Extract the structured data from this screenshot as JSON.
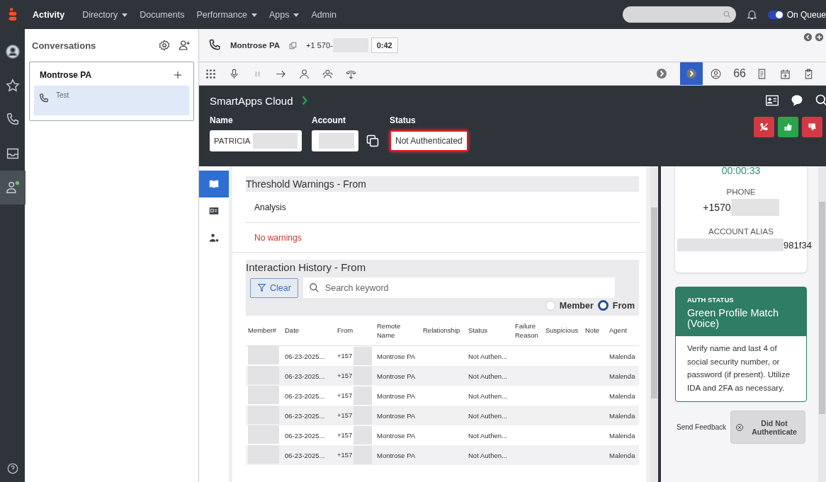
{
  "nav": {
    "items": [
      {
        "label": "Activity",
        "dropdown": false,
        "selected": true
      },
      {
        "label": "Directory",
        "dropdown": true,
        "selected": false
      },
      {
        "label": "Documents",
        "dropdown": false,
        "selected": false
      },
      {
        "label": "Performance",
        "dropdown": true,
        "selected": false
      },
      {
        "label": "Apps",
        "dropdown": true,
        "selected": false
      },
      {
        "label": "Admin",
        "dropdown": false,
        "selected": false
      }
    ],
    "queue": {
      "label": "On Queue",
      "on": true
    }
  },
  "rail": [
    {
      "kind": "avatar",
      "selected": false
    },
    {
      "kind": "star",
      "selected": false
    },
    {
      "kind": "phone",
      "selected": false
    },
    {
      "kind": "inbox",
      "selected": false
    },
    {
      "kind": "agent",
      "selected": true
    }
  ],
  "conversations": {
    "title": "Conversations",
    "groups": [
      {
        "name": "Montrose PA",
        "items": [
          {
            "label": "Test",
            "selected": true
          }
        ]
      }
    ]
  },
  "call": {
    "name": "Montrose PA",
    "phone": "+1 570-",
    "timer": "0:42"
  },
  "toolbar": {
    "count": "66",
    "panels": [
      {
        "kind": "next",
        "selected": false
      },
      {
        "kind": "next",
        "selected": true
      }
    ]
  },
  "smartapps": {
    "title": "SmartApps Cloud",
    "fields": [
      {
        "label": "Name",
        "value": "PATRICIA",
        "alert": false
      },
      {
        "label": "Account",
        "alert": false
      },
      {
        "label": "Status",
        "value": "Not Authenticated",
        "alert": true
      }
    ],
    "actions": [
      {
        "kind": "hangup"
      },
      {
        "kind": "thumbs-up"
      },
      {
        "kind": "thumbs-down"
      }
    ]
  },
  "side_tabs": [
    {
      "kind": "book",
      "selected": true
    },
    {
      "kind": "card",
      "selected": false
    },
    {
      "kind": "user",
      "selected": false
    }
  ],
  "threshold": {
    "title": "Threshold Warnings - From",
    "column": "Analysis",
    "message": "No warnings"
  },
  "history": {
    "title": "Interaction History - From",
    "clear": "Clear",
    "search_placeholder": "Search keyword",
    "radios": [
      {
        "label": "Member",
        "selected": false
      },
      {
        "label": "From",
        "selected": true
      }
    ],
    "columns": [
      "Member#",
      "Date",
      "From",
      "Remote Name",
      "Relationship",
      "Status",
      "Failure Reason",
      "Suspicious",
      "Note",
      "Agent"
    ],
    "rows": [
      {
        "date": "06-23-2025...",
        "from": "+157",
        "remote": "Montrose PA",
        "status": "Not Authen...",
        "agent": "Malenda"
      },
      {
        "date": "06-23-2025...",
        "from": "+157",
        "remote": "Montrose PA",
        "status": "Not Authen...",
        "agent": "Malenda"
      },
      {
        "date": "06-23-2025...",
        "from": "+157",
        "remote": "Montrose PA",
        "status": "Not Authen...",
        "agent": "Malenda"
      },
      {
        "date": "06-23-2025...",
        "from": "+157",
        "remote": "Montrose PA",
        "status": "Not Authen...",
        "agent": "Malenda"
      },
      {
        "date": "06-23-2025...",
        "from": "+157",
        "remote": "Montrose PA",
        "status": "Not Authen...",
        "agent": "Malenda"
      },
      {
        "date": "06-23-2025...",
        "from": "+157",
        "remote": "Montrose PA",
        "status": "Not Authen...",
        "agent": "Malenda"
      }
    ]
  },
  "auth": {
    "timer": "00:00:33",
    "phone_label": "PHONE",
    "phone": "+1570",
    "alias_label": "ACCOUNT ALIAS",
    "alias": "981f34",
    "status_label": "AUTH STATUS",
    "status_title": "Green Profile Match (Voice)",
    "status_body": "Verify name and last 4 of social security number, or password (if present). Utilize IDA and 2FA as necessary.",
    "feedback": "Send Feedback",
    "button": "Did Not Authenticate"
  }
}
